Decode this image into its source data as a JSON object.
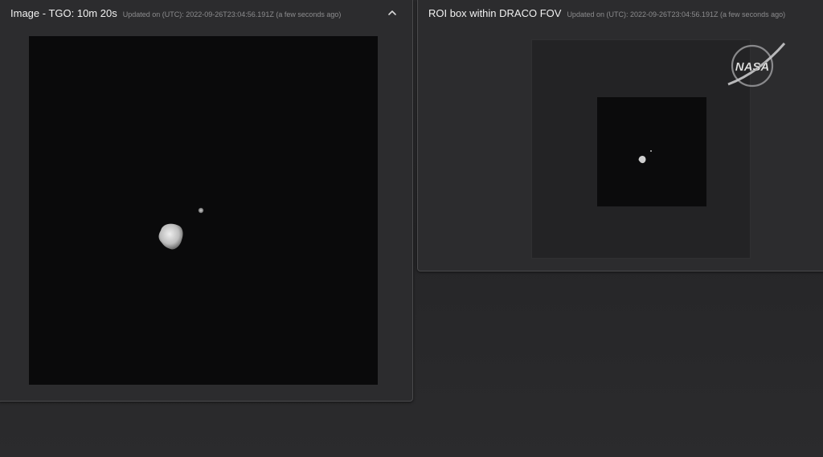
{
  "left_panel": {
    "title": "Image - TGO: 10m 20s",
    "updated": "Updated on (UTC): 2022-09-26T23:04:56.191Z (a few seconds ago)",
    "collapse_icon": "chevron-up-icon"
  },
  "right_panel": {
    "title": "ROI box within DRACO FOV",
    "updated": "Updated on (UTC): 2022-09-26T23:04:56.191Z (a few seconds ago)",
    "logo_text": "NASA"
  },
  "colors": {
    "background": "#2a2a2c",
    "panel": "#2c2c2e",
    "image_black": "#0a0a0b",
    "roi_frame": "#232325",
    "muted_text": "#8c8c8e"
  }
}
